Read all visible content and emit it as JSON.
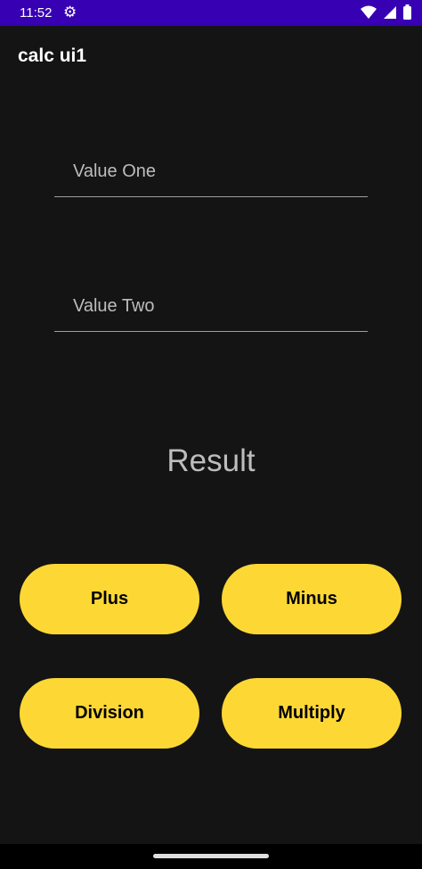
{
  "status_bar": {
    "time": "11:52",
    "icons": [
      "settings-icon",
      "wifi-icon",
      "signal-icon",
      "battery-icon"
    ]
  },
  "app_bar": {
    "title": "calc ui1"
  },
  "inputs": {
    "value_one": {
      "placeholder": "Value One",
      "value": ""
    },
    "value_two": {
      "placeholder": "Value Two",
      "value": ""
    }
  },
  "result": {
    "text": "Result"
  },
  "buttons": {
    "plus": "Plus",
    "minus": "Minus",
    "division": "Division",
    "multiply": "Multiply"
  },
  "colors": {
    "status_bar": "#3700b3",
    "background": "#141414",
    "button": "#fdd835",
    "button_text": "#000000"
  }
}
